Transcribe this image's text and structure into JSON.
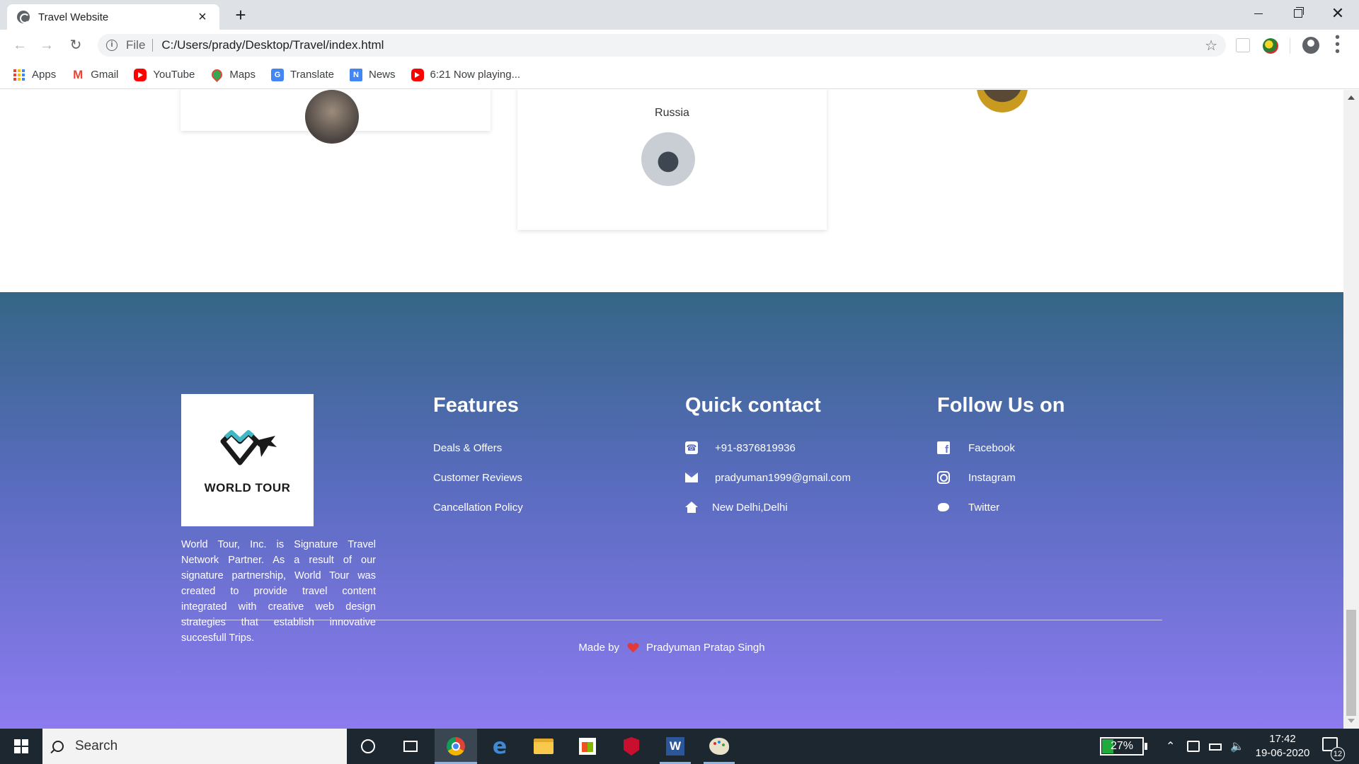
{
  "browser": {
    "tab_title": "Travel Website",
    "tab_close": "×",
    "new_tab": "+",
    "scheme_label": "File",
    "url": "C:/Users/prady/Desktop/Travel/index.html",
    "window_close": "✕"
  },
  "bookmarks": [
    {
      "label": "Apps",
      "icon": "apps-grid-icon"
    },
    {
      "label": "Gmail",
      "icon": "gmail-icon"
    },
    {
      "label": "YouTube",
      "icon": "youtube-icon"
    },
    {
      "label": "Maps",
      "icon": "maps-pin-icon"
    },
    {
      "label": "Translate",
      "icon": "translate-icon"
    },
    {
      "label": "News",
      "icon": "news-icon"
    },
    {
      "label": "6:21 Now playing...",
      "icon": "youtube-icon"
    }
  ],
  "testimonials": {
    "middle_country": "Russia"
  },
  "footer": {
    "logo_text": "WORLD TOUR",
    "about": "World Tour, Inc. is Signature Travel Network Partner. As a result of our signature partnership, World Tour was created to provide travel content integrated with creative web design strategies that establish innovative succesfull Trips.",
    "features": {
      "heading": "Features",
      "links": [
        "Deals & Offers",
        "Customer Reviews",
        "Cancellation Policy"
      ]
    },
    "contact": {
      "heading": "Quick contact",
      "phone": "+91-8376819936",
      "email": "pradyuman1999@gmail.com",
      "address": "New Delhi,Delhi"
    },
    "follow": {
      "heading": "Follow Us on",
      "links": [
        "Facebook",
        "Instagram",
        "Twitter"
      ]
    },
    "made_by_prefix": "Made by",
    "author": "Pradyuman Pratap Singh"
  },
  "taskbar": {
    "search_placeholder": "Search",
    "battery_percent": "27%",
    "battery_level": 0.27,
    "time": "17:42",
    "date": "19-06-2020",
    "notification_count": "12"
  },
  "colors": {
    "footer_top": "#356686",
    "footer_bottom": "#8d7bf0",
    "heart": "#e53935"
  }
}
